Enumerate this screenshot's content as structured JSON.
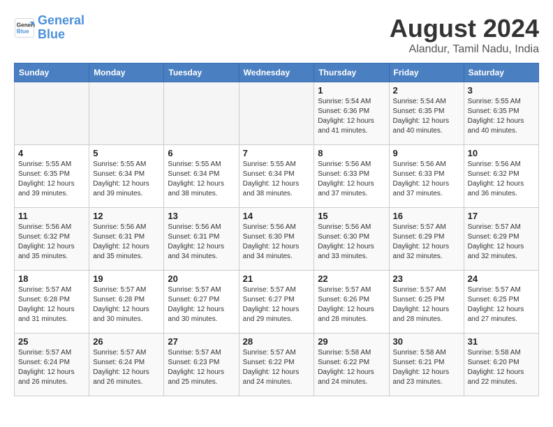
{
  "header": {
    "logo_line1": "General",
    "logo_line2": "Blue",
    "month_year": "August 2024",
    "location": "Alandur, Tamil Nadu, India"
  },
  "weekdays": [
    "Sunday",
    "Monday",
    "Tuesday",
    "Wednesday",
    "Thursday",
    "Friday",
    "Saturday"
  ],
  "weeks": [
    [
      {
        "day": "",
        "info": ""
      },
      {
        "day": "",
        "info": ""
      },
      {
        "day": "",
        "info": ""
      },
      {
        "day": "",
        "info": ""
      },
      {
        "day": "1",
        "info": "Sunrise: 5:54 AM\nSunset: 6:36 PM\nDaylight: 12 hours\nand 41 minutes."
      },
      {
        "day": "2",
        "info": "Sunrise: 5:54 AM\nSunset: 6:35 PM\nDaylight: 12 hours\nand 40 minutes."
      },
      {
        "day": "3",
        "info": "Sunrise: 5:55 AM\nSunset: 6:35 PM\nDaylight: 12 hours\nand 40 minutes."
      }
    ],
    [
      {
        "day": "4",
        "info": "Sunrise: 5:55 AM\nSunset: 6:35 PM\nDaylight: 12 hours\nand 39 minutes."
      },
      {
        "day": "5",
        "info": "Sunrise: 5:55 AM\nSunset: 6:34 PM\nDaylight: 12 hours\nand 39 minutes."
      },
      {
        "day": "6",
        "info": "Sunrise: 5:55 AM\nSunset: 6:34 PM\nDaylight: 12 hours\nand 38 minutes."
      },
      {
        "day": "7",
        "info": "Sunrise: 5:55 AM\nSunset: 6:34 PM\nDaylight: 12 hours\nand 38 minutes."
      },
      {
        "day": "8",
        "info": "Sunrise: 5:56 AM\nSunset: 6:33 PM\nDaylight: 12 hours\nand 37 minutes."
      },
      {
        "day": "9",
        "info": "Sunrise: 5:56 AM\nSunset: 6:33 PM\nDaylight: 12 hours\nand 37 minutes."
      },
      {
        "day": "10",
        "info": "Sunrise: 5:56 AM\nSunset: 6:32 PM\nDaylight: 12 hours\nand 36 minutes."
      }
    ],
    [
      {
        "day": "11",
        "info": "Sunrise: 5:56 AM\nSunset: 6:32 PM\nDaylight: 12 hours\nand 35 minutes."
      },
      {
        "day": "12",
        "info": "Sunrise: 5:56 AM\nSunset: 6:31 PM\nDaylight: 12 hours\nand 35 minutes."
      },
      {
        "day": "13",
        "info": "Sunrise: 5:56 AM\nSunset: 6:31 PM\nDaylight: 12 hours\nand 34 minutes."
      },
      {
        "day": "14",
        "info": "Sunrise: 5:56 AM\nSunset: 6:30 PM\nDaylight: 12 hours\nand 34 minutes."
      },
      {
        "day": "15",
        "info": "Sunrise: 5:56 AM\nSunset: 6:30 PM\nDaylight: 12 hours\nand 33 minutes."
      },
      {
        "day": "16",
        "info": "Sunrise: 5:57 AM\nSunset: 6:29 PM\nDaylight: 12 hours\nand 32 minutes."
      },
      {
        "day": "17",
        "info": "Sunrise: 5:57 AM\nSunset: 6:29 PM\nDaylight: 12 hours\nand 32 minutes."
      }
    ],
    [
      {
        "day": "18",
        "info": "Sunrise: 5:57 AM\nSunset: 6:28 PM\nDaylight: 12 hours\nand 31 minutes."
      },
      {
        "day": "19",
        "info": "Sunrise: 5:57 AM\nSunset: 6:28 PM\nDaylight: 12 hours\nand 30 minutes."
      },
      {
        "day": "20",
        "info": "Sunrise: 5:57 AM\nSunset: 6:27 PM\nDaylight: 12 hours\nand 30 minutes."
      },
      {
        "day": "21",
        "info": "Sunrise: 5:57 AM\nSunset: 6:27 PM\nDaylight: 12 hours\nand 29 minutes."
      },
      {
        "day": "22",
        "info": "Sunrise: 5:57 AM\nSunset: 6:26 PM\nDaylight: 12 hours\nand 28 minutes."
      },
      {
        "day": "23",
        "info": "Sunrise: 5:57 AM\nSunset: 6:25 PM\nDaylight: 12 hours\nand 28 minutes."
      },
      {
        "day": "24",
        "info": "Sunrise: 5:57 AM\nSunset: 6:25 PM\nDaylight: 12 hours\nand 27 minutes."
      }
    ],
    [
      {
        "day": "25",
        "info": "Sunrise: 5:57 AM\nSunset: 6:24 PM\nDaylight: 12 hours\nand 26 minutes."
      },
      {
        "day": "26",
        "info": "Sunrise: 5:57 AM\nSunset: 6:24 PM\nDaylight: 12 hours\nand 26 minutes."
      },
      {
        "day": "27",
        "info": "Sunrise: 5:57 AM\nSunset: 6:23 PM\nDaylight: 12 hours\nand 25 minutes."
      },
      {
        "day": "28",
        "info": "Sunrise: 5:57 AM\nSunset: 6:22 PM\nDaylight: 12 hours\nand 24 minutes."
      },
      {
        "day": "29",
        "info": "Sunrise: 5:58 AM\nSunset: 6:22 PM\nDaylight: 12 hours\nand 24 minutes."
      },
      {
        "day": "30",
        "info": "Sunrise: 5:58 AM\nSunset: 6:21 PM\nDaylight: 12 hours\nand 23 minutes."
      },
      {
        "day": "31",
        "info": "Sunrise: 5:58 AM\nSunset: 6:20 PM\nDaylight: 12 hours\nand 22 minutes."
      }
    ]
  ]
}
